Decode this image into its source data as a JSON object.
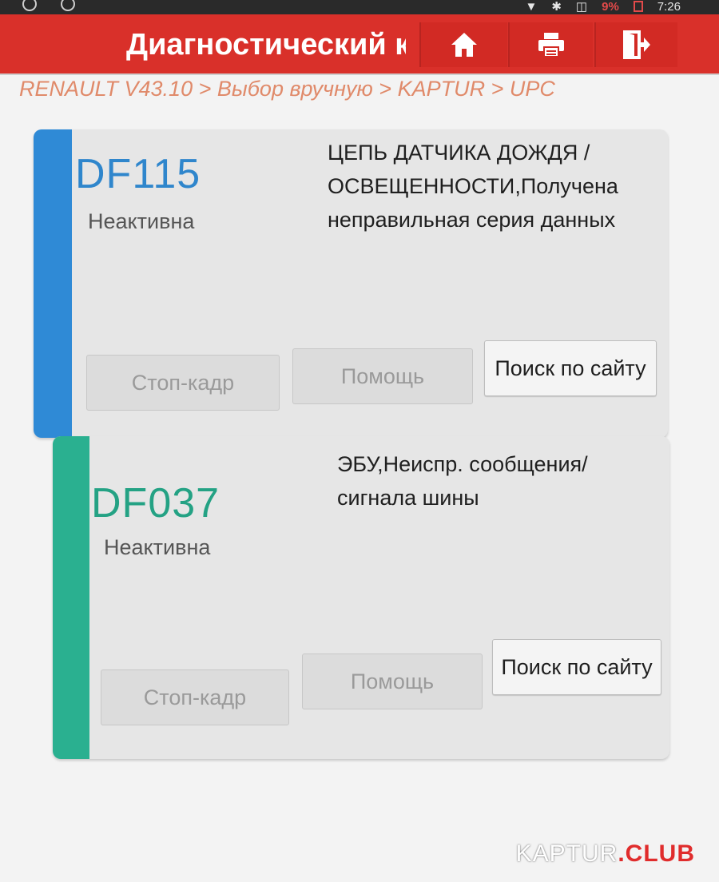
{
  "status_bar": {
    "battery_percent": "9%",
    "time": "7:26"
  },
  "header": {
    "title": "Диагностический к",
    "buttons": {
      "home_icon": "home-icon",
      "print_icon": "print-icon",
      "exit_icon": "exit-icon"
    },
    "colors": {
      "bar": "#d9302a"
    }
  },
  "breadcrumb": "RENAULT V43.10 > Выбор вручную > KAPTUR > UPC",
  "dtcs": [
    {
      "code": "DF115",
      "status": "Неактивна",
      "description": "ЦЕПЬ ДАТЧИКА ДОЖДЯ /\nОСВЕЩЕННОСТИ,Получена\nнеправильная серия данных",
      "accent_color": "#2f8ad6",
      "buttons": {
        "freeze_frame": "Стоп-кадр",
        "help": "Помощь",
        "site_search": "Поиск по сайту"
      }
    },
    {
      "code": "DF037",
      "status": "Неактивна",
      "description": "ЭБУ,Неиспр. сообщения/\nсигнала шины",
      "accent_color": "#2ab090",
      "buttons": {
        "freeze_frame": "Стоп-кадр",
        "help": "Помощь",
        "site_search": "Поиск по сайту"
      }
    }
  ],
  "watermark": {
    "part1": "KAPTUR",
    "part2": ".CLUB"
  }
}
